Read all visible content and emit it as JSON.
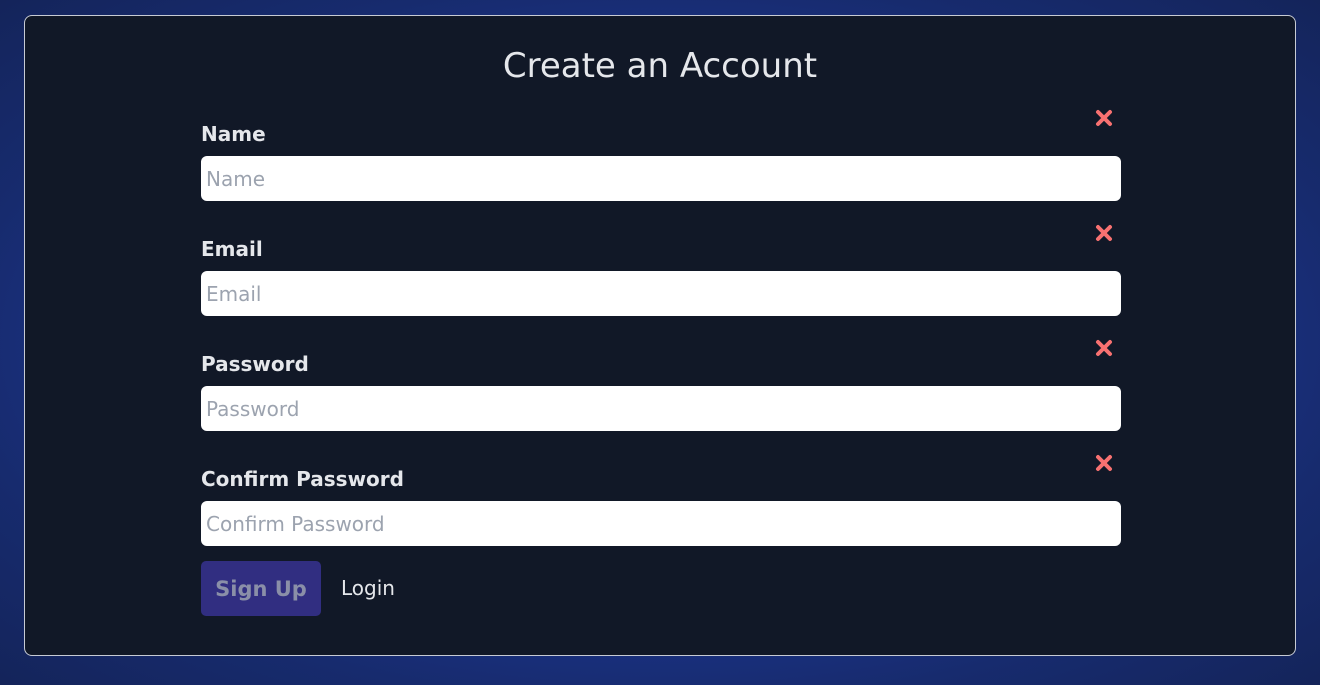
{
  "form": {
    "title": "Create an Account",
    "fields": [
      {
        "label": "Name",
        "placeholder": "Name",
        "value": "",
        "error_icon": "close-x-icon"
      },
      {
        "label": "Email",
        "placeholder": "Email",
        "value": "",
        "error_icon": "close-x-icon"
      },
      {
        "label": "Password",
        "placeholder": "Password",
        "value": "",
        "error_icon": "close-x-icon"
      },
      {
        "label": "Confirm Password",
        "placeholder": "Confirm Password",
        "value": "",
        "error_icon": "close-x-icon"
      }
    ],
    "signup_label": "Sign Up",
    "login_label": "Login"
  },
  "colors": {
    "card_background": "#111827",
    "error_icon": "#f87171",
    "button_background": "#312e81",
    "button_text": "#8a8fa8",
    "page_background": "#1e3aa0"
  }
}
